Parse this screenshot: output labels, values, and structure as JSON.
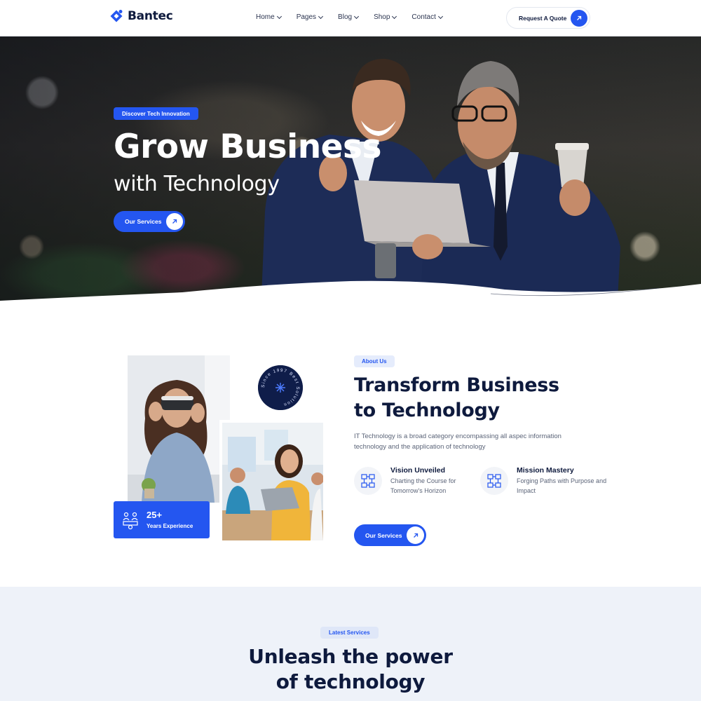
{
  "brand": {
    "name": "Bantec",
    "accent": "#2456f0",
    "dark": "#0e1a3d"
  },
  "nav": {
    "items": [
      {
        "label": "Home"
      },
      {
        "label": "Pages"
      },
      {
        "label": "Blog"
      },
      {
        "label": "Shop"
      },
      {
        "label": "Contact"
      }
    ],
    "cta_label": "Request A Quote"
  },
  "hero": {
    "tag": "Discover Tech Innovation",
    "title_line1": "Grow Business",
    "title_line2": "with Technology",
    "button_label": "Our Services"
  },
  "about": {
    "tag": "About Us",
    "title_line1": "Transform Business",
    "title_line2": "to Technology",
    "description": "IT Technology is a broad category encompassing all aspec information technology and the application of technology",
    "experience_number": "25+",
    "experience_label": "Years Experience",
    "badge_text": "Since 1997 Best Solution",
    "features": [
      {
        "title": "Vision Unveiled",
        "desc": "Charting the Course for Tomorrow's Horizon",
        "icon": "network-icon"
      },
      {
        "title": "Mission Mastery",
        "desc": "Forging Paths with Purpose and Impact",
        "icon": "network-icon"
      }
    ],
    "button_label": "Our Services"
  },
  "services": {
    "tag": "Latest Services",
    "title_line1": "Unleash the power",
    "title_line2": "of technology"
  }
}
